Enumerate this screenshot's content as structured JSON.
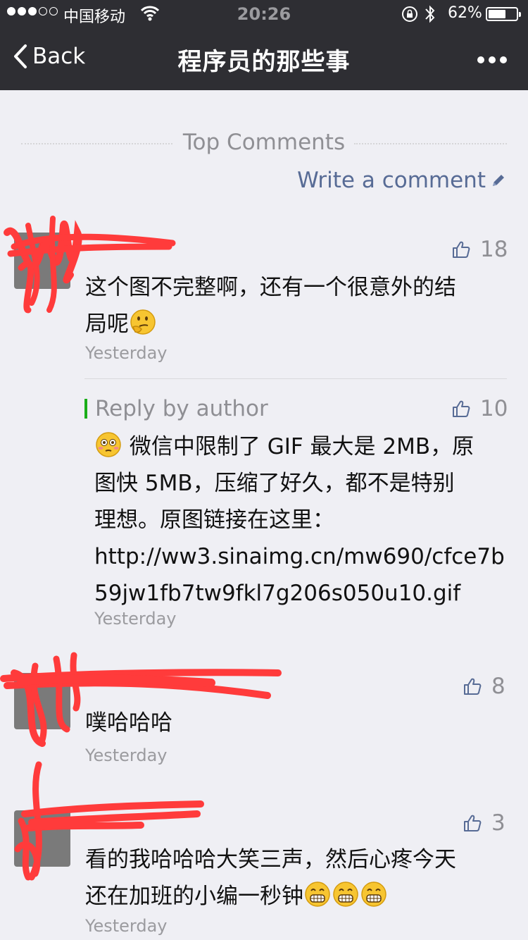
{
  "status": {
    "carrier": "中国移动",
    "time": "20:26",
    "battery_pct": "62%",
    "battery_level": 0.62
  },
  "nav": {
    "back_label": "Back",
    "title": "程序员的那些事"
  },
  "section": {
    "title": "Top Comments",
    "write_label": "Write a comment"
  },
  "comments": [
    {
      "likes": "18",
      "text_1": "这个图不完整啊，还有一个很意外的结",
      "text_2": "局呢",
      "emoji": "thinking-face",
      "time": "Yesterday",
      "reply": {
        "label": "Reply by author",
        "likes": "10",
        "emoji": "flushed-face",
        "text_1": " 微信中限制了 GIF 最大是 2MB，原",
        "text_2": "图快 5MB，压缩了好久，都不是特别",
        "text_3": "理想。原图链接在这里：",
        "link_1": "http://ww3.sinaimg.cn/mw690/cfce7b",
        "link_2": "59jw1fb7tw9fkl7g206s050u10.gif",
        "time": "Yesterday"
      }
    },
    {
      "likes": "8",
      "text_1": "噗哈哈哈",
      "time": "Yesterday"
    },
    {
      "likes": "3",
      "text_1": "看的我哈哈哈大笑三声，然后心疼今天",
      "text_2": "还在加班的小编一秒钟",
      "emoji": "grinning-face",
      "time": "Yesterday"
    }
  ],
  "colors": {
    "navbar": "#2e2e33",
    "background": "#efeff4",
    "link": "#576b95",
    "reply_accent": "#1aad19",
    "redaction": "#ff3b3b"
  }
}
